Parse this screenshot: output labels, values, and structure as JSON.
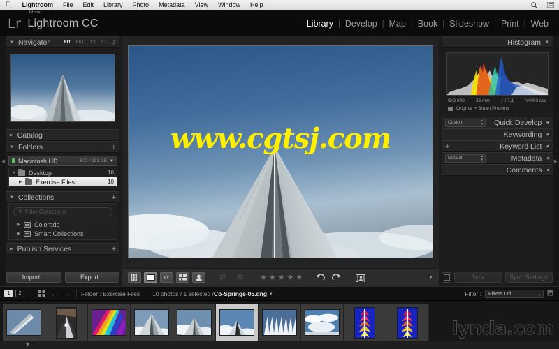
{
  "os_menu": {
    "apple_icon": "apple-icon",
    "items": [
      "Lightroom",
      "File",
      "Edit",
      "Library",
      "Photo",
      "Metadata",
      "View",
      "Window",
      "Help"
    ],
    "right_icons": [
      "search-icon",
      "list-icon"
    ]
  },
  "identity": {
    "logo": "Lr",
    "adobe": "Adobe",
    "product": "Lightroom CC"
  },
  "modules": {
    "items": [
      "Library",
      "Develop",
      "Map",
      "Book",
      "Slideshow",
      "Print",
      "Web"
    ],
    "active": "Library",
    "separator": "|"
  },
  "left_panel": {
    "navigator": {
      "title": "Navigator",
      "zoom_options": [
        "FIT",
        "FILL",
        "1:1",
        "3:1"
      ],
      "active_zoom": "FIT",
      "stepper_icon": "stepper-icon"
    },
    "catalog": {
      "title": "Catalog"
    },
    "folders": {
      "title": "Folders",
      "minus": "−",
      "plus": "+",
      "volume": {
        "name": "Macintosh HD",
        "capacity": "603 / 931 GB"
      },
      "items": [
        {
          "label": "Desktop",
          "count": "10",
          "selected": false,
          "indent": 0
        },
        {
          "label": "Exercise Files",
          "count": "10",
          "selected": true,
          "indent": 1
        }
      ]
    },
    "collections": {
      "title": "Collections",
      "plus": "+",
      "filter_placeholder": "Filter Collections",
      "items": [
        {
          "label": "Colorado"
        },
        {
          "label": "Smart Collections"
        }
      ]
    },
    "publish_services": {
      "title": "Publish Services",
      "plus": "+"
    },
    "import_label": "Import...",
    "export_label": "Export..."
  },
  "photo": {
    "watermark": "www.cgtsj.com",
    "alt": "air-force-academy-chapel-spire"
  },
  "toolbar": {
    "view_grid": "grid-view-icon",
    "view_loupe": "loupe-view-icon",
    "view_compare": "compare-view-icon",
    "view_survey": "survey-view-icon",
    "view_people": "people-view-icon",
    "flag_pick": "flag-pick-icon",
    "flag_reject": "flag-reject-icon",
    "stars": "★",
    "star_count": 5,
    "rotate_left": "rotate-left-icon",
    "rotate_right": "rotate-right-icon",
    "crop_overlay": "crop-overlay-icon",
    "chevron": "▼"
  },
  "right_panel": {
    "histogram": {
      "title": "Histogram",
      "iso": "ISO 640",
      "focal": "35 mm",
      "aperture": "ƒ / 7.1",
      "shutter_num": "1",
      "shutter_den": "4000",
      "shutter_unit": "sec",
      "preview_status": "Original + Smart Preview"
    },
    "sections": [
      {
        "title": "Quick Develop",
        "dropdown": "Custom"
      },
      {
        "title": "Keywording",
        "dropdown": null
      },
      {
        "title": "Keyword List",
        "dropdown": null,
        "plus": "+"
      },
      {
        "title": "Metadata",
        "dropdown": "Default"
      },
      {
        "title": "Comments",
        "dropdown": null
      }
    ],
    "sync_label": "Sync",
    "sync_settings_label": "Sync Settings",
    "sync_icon": "sync-mode-icon"
  },
  "filmstrip_bar": {
    "screen_1": "1",
    "screen_2": "2",
    "grid_icon": "grid-icon",
    "back_arrow": "←",
    "forward_arrow": "→",
    "folder_label": "Folder : Exercise Files",
    "photo_count": "10 photos / 1 selected / ",
    "filename": "Co-Springs-05.dng",
    "filename_caret": "▾",
    "filter_label": "Filter :",
    "filter_value": "Filters Off",
    "filter_stepper": "stepper-icon",
    "filter_badge": "filter-badge-icon"
  },
  "filmstrip": {
    "watermark": "lynda.com",
    "thumbs": [
      {
        "kind": "wing",
        "selected": false,
        "portrait": false
      },
      {
        "kind": "interior",
        "selected": false,
        "portrait": true
      },
      {
        "kind": "rainbow",
        "selected": false,
        "portrait": false
      },
      {
        "kind": "spire-a",
        "selected": false,
        "portrait": false
      },
      {
        "kind": "spire-b",
        "selected": false,
        "portrait": false
      },
      {
        "kind": "spire-c",
        "selected": true,
        "portrait": false
      },
      {
        "kind": "row-spires",
        "selected": false,
        "portrait": false
      },
      {
        "kind": "clouds",
        "selected": false,
        "portrait": false
      },
      {
        "kind": "blue-a",
        "selected": false,
        "portrait": true
      },
      {
        "kind": "blue-b",
        "selected": false,
        "portrait": true
      }
    ]
  },
  "colors": {
    "app_bg": "#1c1c1c",
    "panel_bg": "#252525",
    "center_bg": "#232323",
    "watermark_yellow": "#ffef00",
    "selection_white": "#f2f2f2",
    "sky_blue": "#3f6c99"
  }
}
